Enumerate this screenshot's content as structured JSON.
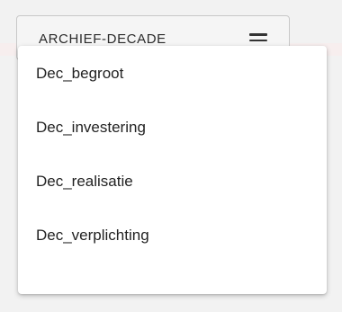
{
  "dropdown": {
    "label": "ARCHIEF-DECADE",
    "icon": "hamburger-menu-icon",
    "options": [
      {
        "label": "Dec_begroot"
      },
      {
        "label": "Dec_investering"
      },
      {
        "label": "Dec_realisatie"
      },
      {
        "label": "Dec_verplichting"
      }
    ]
  }
}
